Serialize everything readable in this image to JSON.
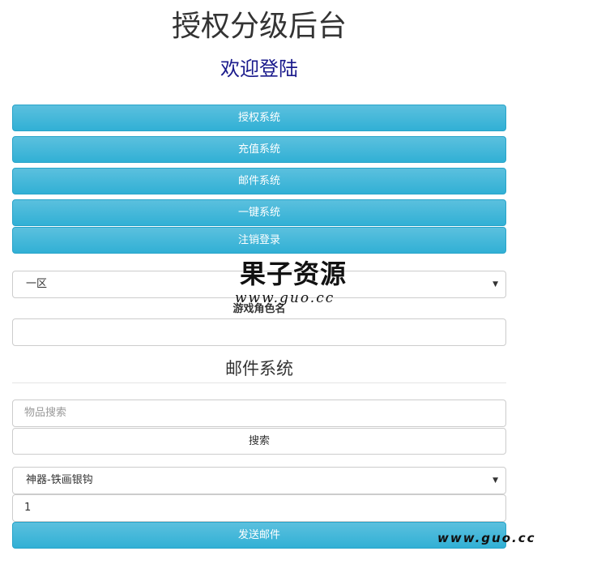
{
  "header": {
    "title": "授权分级后台",
    "welcome": "欢迎登陆"
  },
  "nav_buttons": {
    "auth": "授权系统",
    "recharge": "充值系统",
    "mail": "邮件系统",
    "one_click": "一键系统",
    "logout": "注销登录"
  },
  "server_select": {
    "selected": "一区"
  },
  "role": {
    "label": "游戏角色名",
    "value": ""
  },
  "mail_section": {
    "title": "邮件系统",
    "search_placeholder": "物品搜索",
    "search_button": "搜索",
    "item_selected": "神器-铁画银钩",
    "quantity": "1",
    "send_button": "发送邮件"
  },
  "watermark": {
    "brand": "果子资源",
    "url": "www.guo.cc",
    "corner_url": "www.guo.cc"
  },
  "colors": {
    "primary_button": "#5bc0de",
    "welcome_text": "#1a1a8c"
  }
}
